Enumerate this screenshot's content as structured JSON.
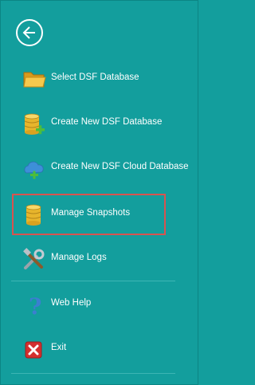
{
  "menu": {
    "items": [
      {
        "key": "select",
        "label": "Select DSF Database",
        "icon": "folder-icon"
      },
      {
        "key": "create",
        "label": "Create New DSF Database",
        "icon": "database-add-icon"
      },
      {
        "key": "cloud",
        "label": "Create New DSF Cloud Database",
        "icon": "cloud-add-icon"
      },
      {
        "key": "snapshots",
        "label": "Manage Snapshots",
        "icon": "database-icon"
      },
      {
        "key": "logs",
        "label": "Manage Logs",
        "icon": "tools-icon"
      },
      {
        "key": "help",
        "label": "Web Help",
        "icon": "help-icon"
      },
      {
        "key": "exit",
        "label": "Exit",
        "icon": "exit-icon"
      }
    ],
    "selected": "Manage Snapshots"
  },
  "colors": {
    "background": "#139e9d",
    "highlight_border": "#d9534f"
  }
}
